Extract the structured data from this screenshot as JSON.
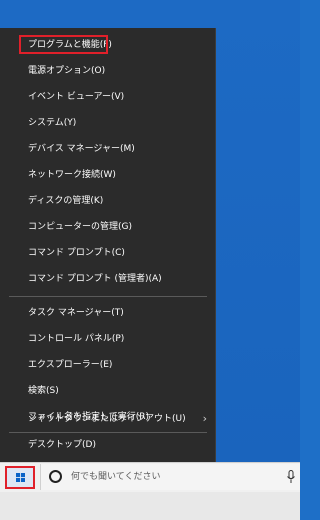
{
  "menu": {
    "items": [
      {
        "label": "プログラムと機能(F)"
      },
      {
        "label": "電源オプション(O)"
      },
      {
        "label": "イベント ビューアー(V)"
      },
      {
        "label": "システム(Y)"
      },
      {
        "label": "デバイス マネージャー(M)"
      },
      {
        "label": "ネットワーク接続(W)"
      },
      {
        "label": "ディスクの管理(K)"
      },
      {
        "label": "コンピューターの管理(G)"
      },
      {
        "label": "コマンド プロンプト(C)"
      },
      {
        "label": "コマンド プロンプト (管理者)(A)"
      },
      {
        "label": "タスク マネージャー(T)"
      },
      {
        "label": "コントロール パネル(P)"
      },
      {
        "label": "エクスプローラー(E)"
      },
      {
        "label": "検索(S)"
      },
      {
        "label": "ファイル名を指定して実行(R)"
      },
      {
        "label": "シャットダウンまたはサインアウト(U)"
      },
      {
        "label": "デスクトップ(D)"
      }
    ],
    "highlight_color": "#e0202a"
  },
  "taskbar": {
    "search_placeholder": "何でも聞いてください",
    "start_icon": "windows-logo-icon",
    "search_icon": "cortana-circle-icon",
    "mic_icon": "microphone-icon"
  },
  "colors": {
    "desktop": "#1d6ac4",
    "menu_bg": "#2b2b2b",
    "menu_text": "#ffffff",
    "taskbar_bg": "#f0f0f0"
  }
}
